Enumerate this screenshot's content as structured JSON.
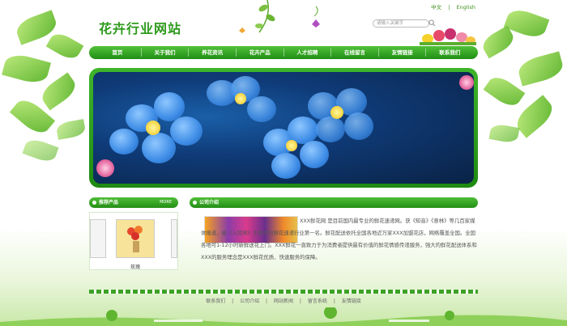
{
  "header": {
    "title": "花卉行业网站",
    "lang_cn": "中文",
    "lang_sep": "|",
    "lang_en": "English",
    "search_placeholder": "请输入关键字"
  },
  "nav": {
    "items": [
      "首页",
      "关于我们",
      "养花资讯",
      "花卉产品",
      "人才招聘",
      "在线留言",
      "友情链接",
      "联系我们"
    ]
  },
  "products": {
    "heading": "推荐产品",
    "more": "MORE",
    "items": [
      {
        "caption": "玫瑰"
      }
    ]
  },
  "about": {
    "heading": "公司介绍",
    "text": "XXX鲜花网 是目前国内最专业的鲜花速递网。获《知音》《意林》等几百家媒体报道，被《人民网》文章评为鲜花速递行业第一名。鲜花配送依托全国各地近万家XXX加盟花店，网络覆盖全国。全国各地可1-12小时新鲜送花上门。XXX鲜花一直致力于为消费者提供最有价值的鲜花情感传递服务，强大的鲜花配送体系和XXX的服务理念是XXX鲜花优质、快速服务的保障。"
  },
  "footer": {
    "links": [
      "联系我们",
      "|",
      "公司介绍",
      "|",
      "网站新闻",
      "|",
      "留言系统",
      "|",
      "友情链接"
    ]
  },
  "colors": {
    "brand_green": "#2d9a1c",
    "nav_green": "#1f8d14",
    "banner_blue": "#3d8ce6"
  }
}
